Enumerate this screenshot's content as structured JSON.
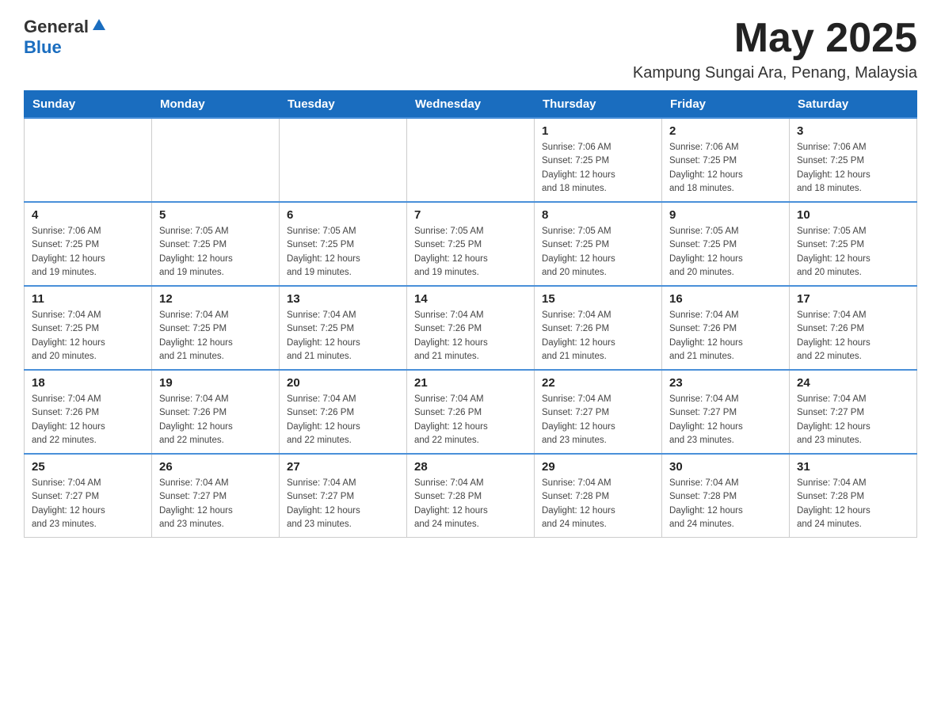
{
  "header": {
    "logo_general": "General",
    "logo_blue": "Blue",
    "month_year": "May 2025",
    "location": "Kampung Sungai Ara, Penang, Malaysia"
  },
  "weekdays": [
    "Sunday",
    "Monday",
    "Tuesday",
    "Wednesday",
    "Thursday",
    "Friday",
    "Saturday"
  ],
  "weeks": [
    {
      "days": [
        {
          "num": "",
          "info": ""
        },
        {
          "num": "",
          "info": ""
        },
        {
          "num": "",
          "info": ""
        },
        {
          "num": "",
          "info": ""
        },
        {
          "num": "1",
          "info": "Sunrise: 7:06 AM\nSunset: 7:25 PM\nDaylight: 12 hours\nand 18 minutes."
        },
        {
          "num": "2",
          "info": "Sunrise: 7:06 AM\nSunset: 7:25 PM\nDaylight: 12 hours\nand 18 minutes."
        },
        {
          "num": "3",
          "info": "Sunrise: 7:06 AM\nSunset: 7:25 PM\nDaylight: 12 hours\nand 18 minutes."
        }
      ]
    },
    {
      "days": [
        {
          "num": "4",
          "info": "Sunrise: 7:06 AM\nSunset: 7:25 PM\nDaylight: 12 hours\nand 19 minutes."
        },
        {
          "num": "5",
          "info": "Sunrise: 7:05 AM\nSunset: 7:25 PM\nDaylight: 12 hours\nand 19 minutes."
        },
        {
          "num": "6",
          "info": "Sunrise: 7:05 AM\nSunset: 7:25 PM\nDaylight: 12 hours\nand 19 minutes."
        },
        {
          "num": "7",
          "info": "Sunrise: 7:05 AM\nSunset: 7:25 PM\nDaylight: 12 hours\nand 19 minutes."
        },
        {
          "num": "8",
          "info": "Sunrise: 7:05 AM\nSunset: 7:25 PM\nDaylight: 12 hours\nand 20 minutes."
        },
        {
          "num": "9",
          "info": "Sunrise: 7:05 AM\nSunset: 7:25 PM\nDaylight: 12 hours\nand 20 minutes."
        },
        {
          "num": "10",
          "info": "Sunrise: 7:05 AM\nSunset: 7:25 PM\nDaylight: 12 hours\nand 20 minutes."
        }
      ]
    },
    {
      "days": [
        {
          "num": "11",
          "info": "Sunrise: 7:04 AM\nSunset: 7:25 PM\nDaylight: 12 hours\nand 20 minutes."
        },
        {
          "num": "12",
          "info": "Sunrise: 7:04 AM\nSunset: 7:25 PM\nDaylight: 12 hours\nand 21 minutes."
        },
        {
          "num": "13",
          "info": "Sunrise: 7:04 AM\nSunset: 7:25 PM\nDaylight: 12 hours\nand 21 minutes."
        },
        {
          "num": "14",
          "info": "Sunrise: 7:04 AM\nSunset: 7:26 PM\nDaylight: 12 hours\nand 21 minutes."
        },
        {
          "num": "15",
          "info": "Sunrise: 7:04 AM\nSunset: 7:26 PM\nDaylight: 12 hours\nand 21 minutes."
        },
        {
          "num": "16",
          "info": "Sunrise: 7:04 AM\nSunset: 7:26 PM\nDaylight: 12 hours\nand 21 minutes."
        },
        {
          "num": "17",
          "info": "Sunrise: 7:04 AM\nSunset: 7:26 PM\nDaylight: 12 hours\nand 22 minutes."
        }
      ]
    },
    {
      "days": [
        {
          "num": "18",
          "info": "Sunrise: 7:04 AM\nSunset: 7:26 PM\nDaylight: 12 hours\nand 22 minutes."
        },
        {
          "num": "19",
          "info": "Sunrise: 7:04 AM\nSunset: 7:26 PM\nDaylight: 12 hours\nand 22 minutes."
        },
        {
          "num": "20",
          "info": "Sunrise: 7:04 AM\nSunset: 7:26 PM\nDaylight: 12 hours\nand 22 minutes."
        },
        {
          "num": "21",
          "info": "Sunrise: 7:04 AM\nSunset: 7:26 PM\nDaylight: 12 hours\nand 22 minutes."
        },
        {
          "num": "22",
          "info": "Sunrise: 7:04 AM\nSunset: 7:27 PM\nDaylight: 12 hours\nand 23 minutes."
        },
        {
          "num": "23",
          "info": "Sunrise: 7:04 AM\nSunset: 7:27 PM\nDaylight: 12 hours\nand 23 minutes."
        },
        {
          "num": "24",
          "info": "Sunrise: 7:04 AM\nSunset: 7:27 PM\nDaylight: 12 hours\nand 23 minutes."
        }
      ]
    },
    {
      "days": [
        {
          "num": "25",
          "info": "Sunrise: 7:04 AM\nSunset: 7:27 PM\nDaylight: 12 hours\nand 23 minutes."
        },
        {
          "num": "26",
          "info": "Sunrise: 7:04 AM\nSunset: 7:27 PM\nDaylight: 12 hours\nand 23 minutes."
        },
        {
          "num": "27",
          "info": "Sunrise: 7:04 AM\nSunset: 7:27 PM\nDaylight: 12 hours\nand 23 minutes."
        },
        {
          "num": "28",
          "info": "Sunrise: 7:04 AM\nSunset: 7:28 PM\nDaylight: 12 hours\nand 24 minutes."
        },
        {
          "num": "29",
          "info": "Sunrise: 7:04 AM\nSunset: 7:28 PM\nDaylight: 12 hours\nand 24 minutes."
        },
        {
          "num": "30",
          "info": "Sunrise: 7:04 AM\nSunset: 7:28 PM\nDaylight: 12 hours\nand 24 minutes."
        },
        {
          "num": "31",
          "info": "Sunrise: 7:04 AM\nSunset: 7:28 PM\nDaylight: 12 hours\nand 24 minutes."
        }
      ]
    }
  ]
}
